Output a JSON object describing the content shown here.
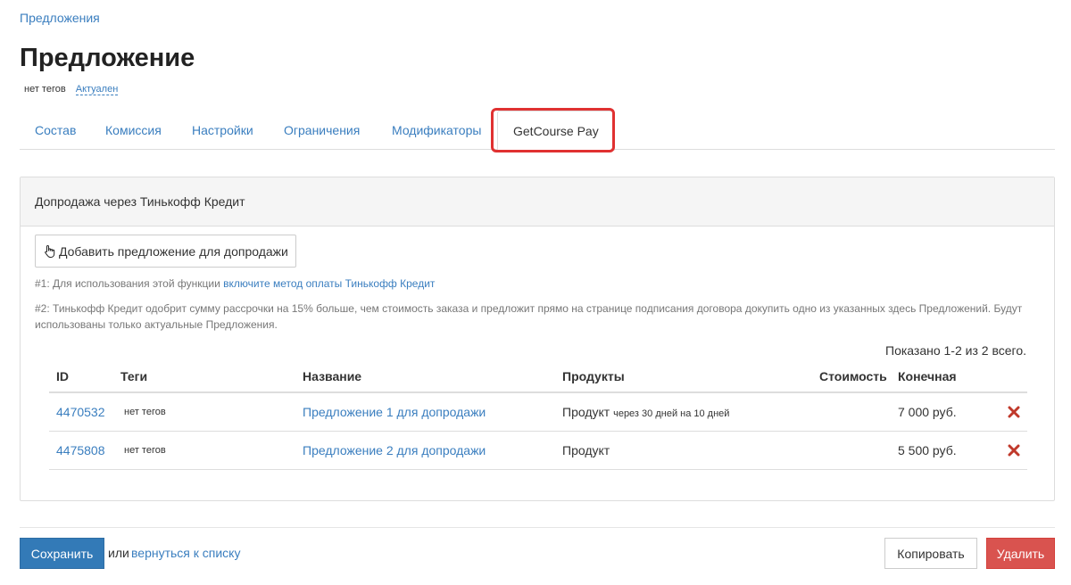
{
  "breadcrumb": "Предложения",
  "page_title": "Предложение",
  "meta": {
    "tags": "нет тегов",
    "status": "Актуален"
  },
  "tabs": [
    {
      "label": "Состав"
    },
    {
      "label": "Комиссия"
    },
    {
      "label": "Настройки"
    },
    {
      "label": "Ограничения"
    },
    {
      "label": "Модификаторы"
    },
    {
      "label": "GetCourse Pay",
      "active": true
    }
  ],
  "panel": {
    "heading": "Допродажа через Тинькофф Кредит",
    "add_button": "Добавить предложение для допродажи",
    "add_icon": "hand-pointer-icon",
    "note1_prefix": "#1: Для использования этой функции ",
    "note1_link": "включите метод оплаты Тинькофф Кредит",
    "note2": "#2: Тинькофф Кредит одобрит сумму рассрочки на 15% больше, чем стоимость заказа и предложит прямо на странице подписания договора докупить одно из указанных здесь Предложений. Будут использованы только актуальные Предложения.",
    "shown_count": "Показано 1-2 из 2 всего."
  },
  "table": {
    "columns": [
      "ID",
      "Теги",
      "Название",
      "Продукты",
      "Стоимость",
      "Конечная"
    ],
    "rows": [
      {
        "id": "4470532",
        "tags": "нет тегов",
        "name": "Предложение 1 для допродажи",
        "product": "Продукт",
        "product_sub": "через 30 дней на 10 дней",
        "final": "7 000 руб."
      },
      {
        "id": "4475808",
        "tags": "нет тегов",
        "name": "Предложение 2 для допродажи",
        "product": "Продукт",
        "product_sub": "",
        "final": "5 500 руб."
      }
    ],
    "delete_icon": "close-icon"
  },
  "footer": {
    "save": "Сохранить",
    "or": "или",
    "back_link": "вернуться к списку",
    "copy": "Копировать",
    "delete": "Удалить"
  },
  "colors": {
    "accent": "#3a7ebf",
    "primary_button": "#337ab7",
    "danger": "#d9534f",
    "highlight": "#e03131",
    "delete_icon": "#c0392b"
  }
}
